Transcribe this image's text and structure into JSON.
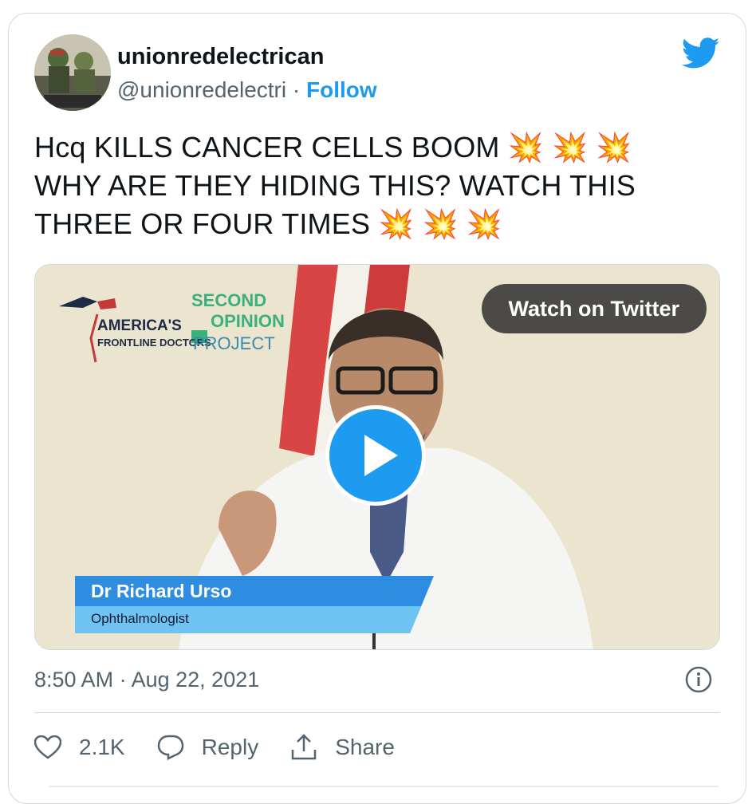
{
  "author": {
    "display_name": "unionredelectrican",
    "handle": "@unionredelectri",
    "separator": "·",
    "follow_label": "Follow"
  },
  "tweet": {
    "text_line1": "Hcq KILLS CANCER CELLS BOOM 💥 💥 💥",
    "text_line2": "WHY ARE THEY HIDING THIS? WATCH THIS",
    "text_line3": "THREE OR FOUR TIMES 💥 💥 💥"
  },
  "media": {
    "watch_label": "Watch on Twitter",
    "overlay_name": "Dr Richard Urso",
    "overlay_title": "Ophthalmologist",
    "brand_line1": "AMERICA'S",
    "brand_line2": "FRONTLINE DOCTORS",
    "project_line1": "SECOND",
    "project_line2": "OPINION",
    "project_line3": "PROJECT"
  },
  "meta": {
    "time": "8:50 AM",
    "separator": "·",
    "date": "Aug 22, 2021"
  },
  "actions": {
    "like_count": "2.1K",
    "reply_label": "Reply",
    "share_label": "Share"
  },
  "colors": {
    "accent": "#1d9bf0",
    "secondary_text": "#536471",
    "border": "#cfd9de"
  }
}
